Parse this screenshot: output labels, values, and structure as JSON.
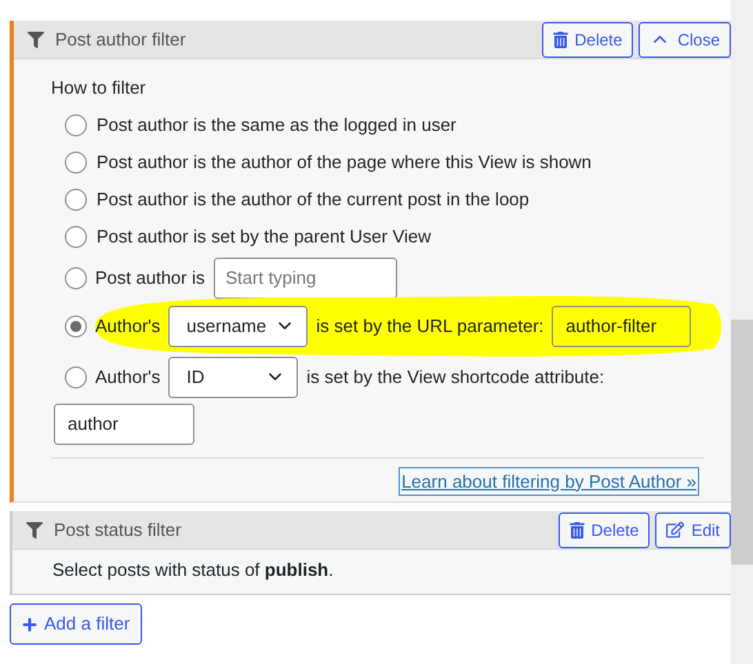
{
  "author_filter": {
    "title": "Post author filter",
    "buttons": [
      {
        "kind": "delete",
        "label": "Delete"
      },
      {
        "kind": "close",
        "label": "Close"
      }
    ],
    "heading": "How to filter",
    "options": [
      {
        "kind": "text",
        "label": "Post author is the same as the logged in user",
        "selected": false
      },
      {
        "kind": "text",
        "label": "Post author is the author of the page where this View is shown",
        "selected": false
      },
      {
        "kind": "text",
        "label": "Post author is the author of the current post in the loop",
        "selected": false
      },
      {
        "kind": "text",
        "label": "Post author is set by the parent User View",
        "selected": false
      },
      {
        "kind": "input",
        "label": "Post author is",
        "placeholder": "Start typing",
        "selected": false
      },
      {
        "kind": "select",
        "label": "Author's",
        "select": "username",
        "after": "is set by the URL parameter:",
        "value": "author-filter",
        "selected": true,
        "highlighted": true
      },
      {
        "kind": "select",
        "label": "Author's",
        "select": "ID",
        "after": "is set by the View shortcode attribute:",
        "value": "author",
        "selected": false,
        "highlighted": false
      }
    ],
    "link": "Learn about filtering by Post Author »"
  },
  "status_filter": {
    "title": "Post status filter",
    "buttons": [
      {
        "kind": "delete",
        "label": "Delete"
      },
      {
        "kind": "edit",
        "label": "Edit"
      }
    ],
    "description": "Select posts with status of **publish**."
  },
  "add_button": "Add a filter"
}
